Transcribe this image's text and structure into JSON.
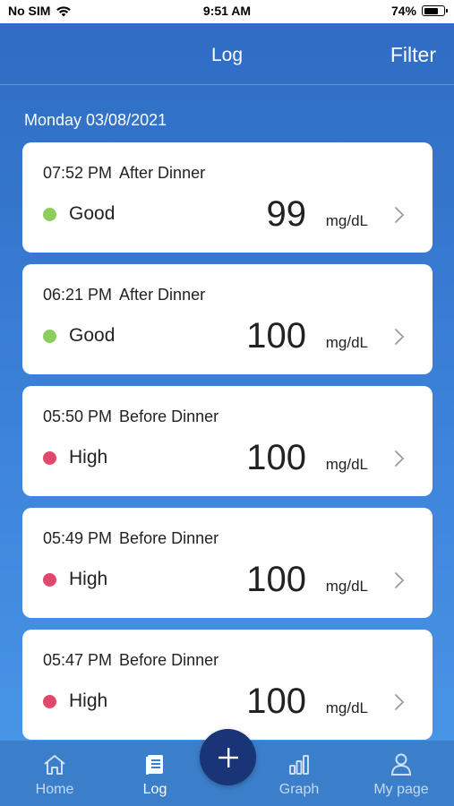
{
  "status_bar": {
    "carrier": "No SIM",
    "time": "9:51 AM",
    "battery": "74%",
    "battery_level": 0.74
  },
  "nav": {
    "title": "Log",
    "filter": "Filter"
  },
  "date_header": "Monday 03/08/2021",
  "colors": {
    "good": "#8dcd5b",
    "high": "#e0486e",
    "fab": "#1a3577"
  },
  "entries": [
    {
      "time": "07:52 PM",
      "meal": "After Dinner",
      "status": "Good",
      "value": "99",
      "unit": "mg/dL"
    },
    {
      "time": "06:21 PM",
      "meal": "After Dinner",
      "status": "Good",
      "value": "100",
      "unit": "mg/dL"
    },
    {
      "time": "05:50 PM",
      "meal": "Before Dinner",
      "status": "High",
      "value": "100",
      "unit": "mg/dL"
    },
    {
      "time": "05:49 PM",
      "meal": "Before Dinner",
      "status": "High",
      "value": "100",
      "unit": "mg/dL"
    },
    {
      "time": "05:47 PM",
      "meal": "Before Dinner",
      "status": "High",
      "value": "100",
      "unit": "mg/dL"
    }
  ],
  "tabs": [
    {
      "label": "Home",
      "icon": "home-icon"
    },
    {
      "label": "Log",
      "icon": "log-icon"
    },
    {
      "label": "Graph",
      "icon": "graph-icon"
    },
    {
      "label": "My page",
      "icon": "person-icon"
    }
  ],
  "fab_icon": "plus-icon"
}
